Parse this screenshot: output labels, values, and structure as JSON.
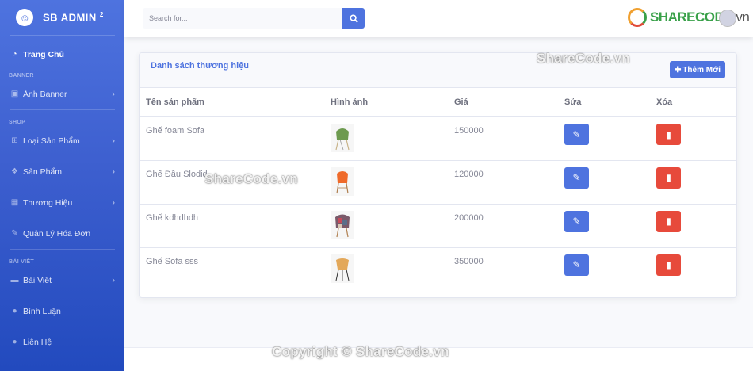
{
  "brand": {
    "name": "SB ADMIN",
    "version": "2"
  },
  "sidebar": {
    "dashboard": "Trang Chủ",
    "heading_banner": "BANNER",
    "banner": "Ảnh Banner",
    "heading_shop": "SHOP",
    "category": "Loại Sản Phẩm",
    "product": "Sản Phẩm",
    "brand_item": "Thương Hiệu",
    "orders": "Quản Lý Hóa Đơn",
    "heading_posts": "BÀI VIẾT",
    "posts": "Bài Viết",
    "comments": "Bình Luận",
    "contact": "Liên Hệ"
  },
  "search": {
    "placeholder": "Search for..."
  },
  "watermark": {
    "logo": "SHARECODE",
    "logo_suffix": ".vn",
    "text": "ShareCode.vn",
    "copyright": "Copyright © ShareCode.vn"
  },
  "card": {
    "title": "Danh sách thương hiệu",
    "add_label": "Thêm Mới",
    "columns": [
      "Tên sản phẩm",
      "Hình ảnh",
      "Giá",
      "Sửa",
      "Xóa"
    ],
    "rows": [
      {
        "name": "Ghế foam Sofa",
        "price": "150000",
        "image": "green-chair"
      },
      {
        "name": "Ghế Đầu Slodid",
        "price": "120000",
        "image": "orange-chair"
      },
      {
        "name": "Ghế kdhdhdh",
        "price": "200000",
        "image": "patchwork-chair"
      },
      {
        "name": "Ghế Sofa sss",
        "price": "350000",
        "image": "wood-chair"
      }
    ]
  },
  "colors": {
    "primary": "#4e73df",
    "danger": "#e74a3b"
  }
}
